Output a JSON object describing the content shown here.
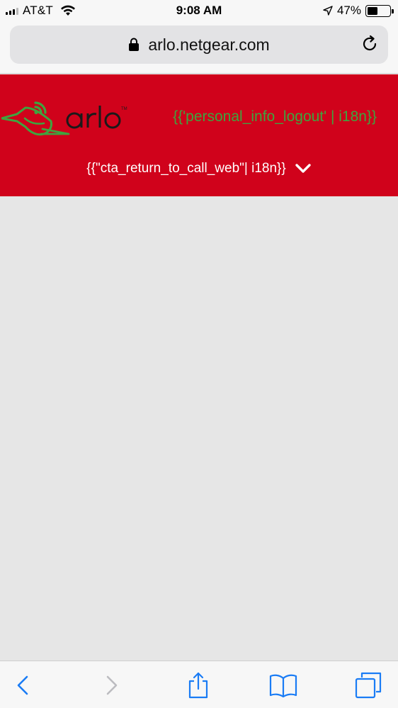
{
  "status_bar": {
    "carrier": "AT&T",
    "time": "9:08 AM",
    "battery_percent_label": "47%",
    "battery_level": 0.47,
    "icons": [
      "signal-icon",
      "wifi-icon",
      "location-arrow-icon",
      "battery-icon"
    ]
  },
  "browser": {
    "url": "arlo.netgear.com",
    "icons": [
      "lock-icon",
      "reload-icon"
    ]
  },
  "header": {
    "logo_alt": "arlo",
    "logout_text": "{{'personal_info_logout' | i18n}}",
    "cta_text": "{{\"cta_return_to_call_web\"| i18n}}",
    "colors": {
      "background": "#d0021b",
      "logout_text": "#3fa43f",
      "logo_green": "#3fa43f",
      "logo_dark": "#1a1a1a"
    }
  },
  "toolbar": {
    "icons": [
      "back-icon",
      "forward-icon",
      "share-icon",
      "bookmarks-icon",
      "tabs-icon"
    ],
    "accent_color": "#1a7cf5"
  }
}
